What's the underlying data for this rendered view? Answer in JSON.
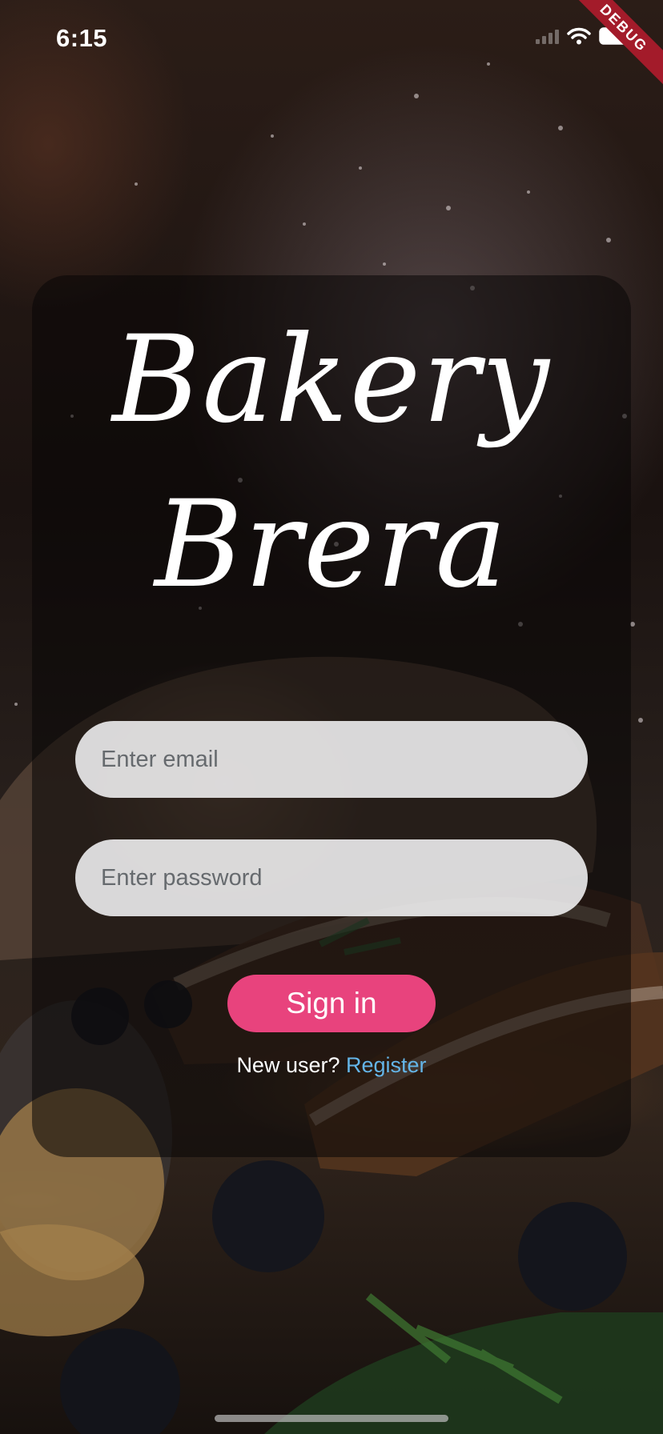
{
  "status_bar": {
    "time": "6:15",
    "icons": [
      "cellular-signal-icon",
      "wifi-icon",
      "battery-icon"
    ]
  },
  "debug_banner": "DEBUG",
  "app": {
    "title_line1": "Bakery",
    "title_line2": "Brera"
  },
  "login": {
    "email_placeholder": "Enter email",
    "password_placeholder": "Enter password",
    "signin_label": "Sign in",
    "new_user_text": "New user?",
    "register_label": "Register"
  },
  "colors": {
    "accent": "#e8437d",
    "link": "#64b5e8",
    "debug_ribbon": "#a31b2a"
  }
}
